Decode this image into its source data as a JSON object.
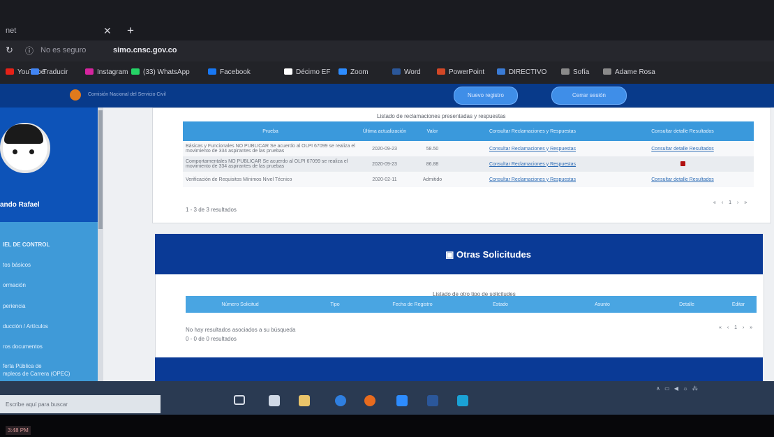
{
  "browser": {
    "tab_title": "net",
    "not_secure": "No es seguro",
    "url": "simo.cnsc.gov.co",
    "bookmarks": [
      {
        "label": "YouTube",
        "color": "#e62117"
      },
      {
        "label": "Traducir",
        "color": "#4285f4"
      },
      {
        "label": "Instagram",
        "color": "#d6249f"
      },
      {
        "label": "(33) WhatsApp",
        "color": "#25d366"
      },
      {
        "label": "Facebook",
        "color": "#1877f2"
      },
      {
        "label": "Décimo EF",
        "color": "#ffffff"
      },
      {
        "label": "Zoom",
        "color": "#2d8cff"
      },
      {
        "label": "Word",
        "color": "#2b579a"
      },
      {
        "label": "PowerPoint",
        "color": "#d24726"
      },
      {
        "label": "DIRECTIVO",
        "color": "#3a7bd5"
      },
      {
        "label": "Sofía",
        "color": "#8a8a8a"
      },
      {
        "label": "Adame Rosa",
        "color": "#8a8a8a"
      }
    ]
  },
  "header": {
    "org_text": "Comisión Nacional del Servicio Civil",
    "button_1": "Nuevo registro",
    "button_2": "Cerrar sesión"
  },
  "sidebar": {
    "username": "ando Rafael",
    "items": [
      "IEL DE CONTROL",
      "tos básicos",
      "ormación",
      "periencia",
      "ducción / Artículos",
      "ros documentos",
      "ferta Pública de",
      "mpleos de Carrera (OPEC)"
    ]
  },
  "reclamaciones": {
    "caption": "Listado de reclamaciones presentadas y respuestas",
    "columns": [
      "Prueba",
      "Última actualización",
      "Valor",
      "Consultar Reclamaciones y Respuestas",
      "Consultar detalle Resultados"
    ],
    "rows": [
      {
        "prueba": "Básicas y Funcionales NO PUBLICAR Se acuerdo al OLPI 67099 se realiza el movimiento de 334 aspirantes de las pruebas",
        "fecha": "2020-09-23",
        "valor": "58.50",
        "reclamaciones": "Consultar Reclamaciones y Respuestas",
        "detalle": "Consultar detalle Resultados"
      },
      {
        "prueba": "Comportamentales NO PUBLICAR Se acuerdo al OLPI 67099 se realiza el movimiento de 334 aspirantes de las pruebas",
        "fecha": "2020-09-23",
        "valor": "86.88",
        "reclamaciones": "Consultar Reclamaciones y Respuestas",
        "detalle": ""
      },
      {
        "prueba": "Verificación de Requisitos Mínimos Nivel Técnico",
        "fecha": "2020-02-11",
        "valor": "Admitido",
        "reclamaciones": "Consultar Reclamaciones y Respuestas",
        "detalle": "Consultar detalle Resultados"
      }
    ],
    "results_text": "1 - 3 de 3 resultados",
    "pager": "« ‹ 1 › »"
  },
  "otras": {
    "title": "Otras Solicitudes",
    "caption": "Listado de otro tipo de solicitudes",
    "columns": [
      "Número Solicitud",
      "Tipo",
      "Fecha de Registro",
      "Estado",
      "Asunto",
      "Detalle",
      "Editar"
    ],
    "no_results": "No hay resultados asociados a su búsqueda",
    "results_text": "0 - 0 de 0 resultados",
    "pager": "« ‹ 1 › »"
  },
  "taskbar": {
    "search_placeholder": "Escribe aquí para buscar",
    "tray": "∧ ▭ ◀ ☼ ⁂"
  },
  "corner_label": "3:48 PM"
}
